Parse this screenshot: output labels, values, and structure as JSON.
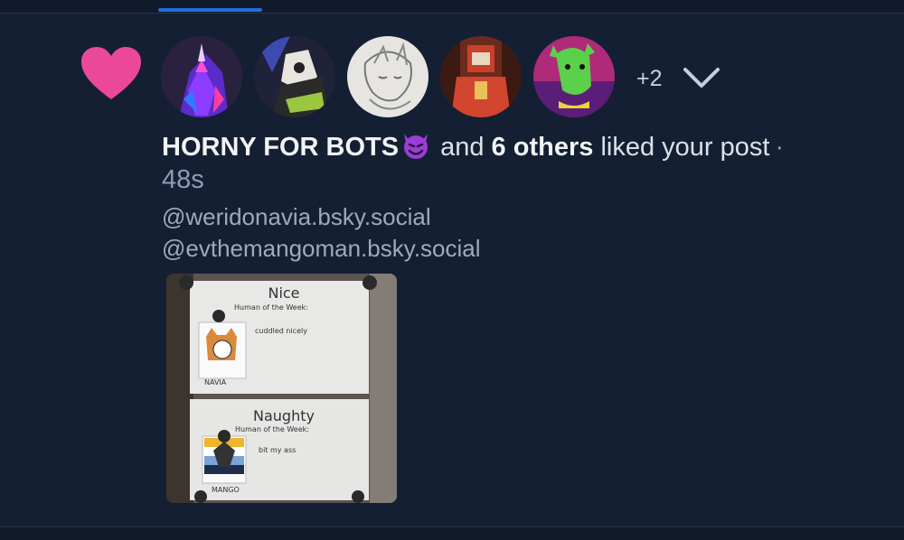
{
  "notification": {
    "liker_name": "HORNY FOR BOTS",
    "emoji": "😈",
    "and_text": "and",
    "others_text": "6 others",
    "action_text": "liked your post",
    "separator": "·",
    "time": "48s",
    "handles": [
      "@weridonavia.bsky.social",
      "@evthemangoman.bsky.social"
    ],
    "more_count": "+2"
  },
  "icons": {
    "like": "heart-icon",
    "expand": "chevron-down-icon"
  },
  "colors": {
    "background": "#141f33",
    "heart": "#ec4899",
    "tab_active": "#1f6fd8",
    "muted_text": "#8d9db3"
  },
  "post_image": {
    "top_title": "Nice",
    "top_subtitle": "Human of the Week:",
    "top_note": "cuddled nicely",
    "top_name": "NAVIA",
    "bottom_title": "Naughty",
    "bottom_subtitle": "Human of the Week:",
    "bottom_note": "bit my ass",
    "bottom_name": "MANGO"
  }
}
